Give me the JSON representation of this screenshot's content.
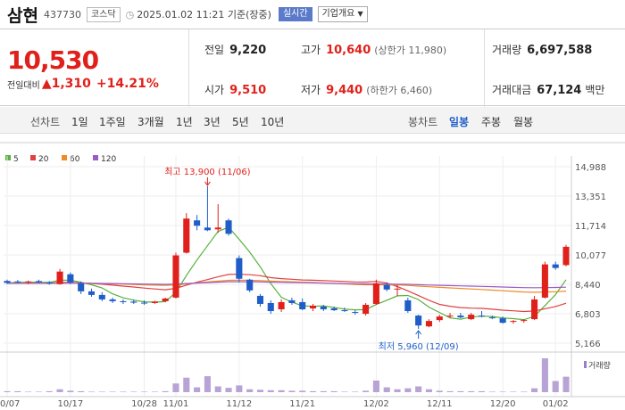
{
  "header": {
    "name": "삼현",
    "code": "437730",
    "market": "코스닥",
    "datetime": "2025.01.02 11:21 기준(장중)",
    "live_label": "실시간",
    "company_info_label": "기업개요"
  },
  "quote": {
    "price": "10,530",
    "change_label": "전일대비",
    "change": "1,310",
    "change_pct": "+14.21%",
    "prev_close_label": "전일",
    "prev_close": "9,220",
    "open_label": "시가",
    "open": "9,510",
    "high_label": "고가",
    "high": "10,640",
    "upper_limit": "(상한가 11,980)",
    "low_label": "저가",
    "low": "9,440",
    "lower_limit": "(하한가 6,460)",
    "volume_label": "거래량",
    "volume": "6,697,588",
    "amount_label": "거래대금",
    "amount": "67,124",
    "amount_unit": "백만"
  },
  "tabs": {
    "line_label": "선차트",
    "line_items": [
      "1일",
      "1주일",
      "3개월",
      "1년",
      "3년",
      "5년",
      "10년"
    ],
    "candle_label": "봉차트",
    "candle_items": [
      "일봉",
      "주봉",
      "월봉"
    ],
    "candle_active": "일봉"
  },
  "colors": {
    "up": "#e0211b",
    "down": "#1f5ec9",
    "ma5": "#57b03c",
    "ma20": "#e04040",
    "ma60": "#f08a24",
    "ma120": "#9a5bc8"
  },
  "chart_data": {
    "type": "candlestick",
    "legend": [
      {
        "label": "5",
        "color": "#57b03c"
      },
      {
        "label": "20",
        "color": "#e04040"
      },
      {
        "label": "60",
        "color": "#f08a24"
      },
      {
        "label": "120",
        "color": "#9a5bc8"
      }
    ],
    "y_ticks": [
      "14,988",
      "13,351",
      "11,714",
      "10,077",
      "8,440",
      "6,803",
      "5,166"
    ],
    "y_tick_values": [
      14988,
      13351,
      11714,
      10077,
      8440,
      6803,
      5166
    ],
    "ylim": [
      5166,
      14988
    ],
    "x_labels": [
      "10/07",
      "10/17",
      "10/28",
      "11/01",
      "11/12",
      "11/21",
      "12/02",
      "12/11",
      "12/20",
      "01/02"
    ],
    "x_label_index": [
      0,
      6,
      13,
      16,
      22,
      28,
      35,
      41,
      47,
      52
    ],
    "volume_label": "거래량",
    "annotation_high": "최고 13,900 (11/06)",
    "annotation_low": "최저 5,960 (12/09)",
    "candles": [
      [
        8630,
        8700,
        8450,
        8520
      ],
      [
        8600,
        8680,
        8480,
        8560
      ],
      [
        8560,
        8650,
        8450,
        8600
      ],
      [
        8620,
        8700,
        8500,
        8550
      ],
      [
        8550,
        8620,
        8420,
        8480
      ],
      [
        8450,
        9300,
        8420,
        9150
      ],
      [
        9000,
        9100,
        8450,
        8550
      ],
      [
        8500,
        8600,
        7900,
        8050
      ],
      [
        8050,
        8200,
        7750,
        7850
      ],
      [
        7850,
        8000,
        7500,
        7600
      ],
      [
        7600,
        7700,
        7400,
        7500
      ],
      [
        7500,
        7600,
        7350,
        7450
      ],
      [
        7480,
        7580,
        7350,
        7420
      ],
      [
        7420,
        7550,
        7300,
        7380
      ],
      [
        7400,
        7520,
        7350,
        7480
      ],
      [
        7500,
        7700,
        7450,
        7650
      ],
      [
        7700,
        10200,
        7650,
        10050
      ],
      [
        10200,
        12400,
        10150,
        12100
      ],
      [
        12000,
        12300,
        11450,
        11700
      ],
      [
        11600,
        13900,
        11400,
        11450
      ],
      [
        11500,
        12900,
        11300,
        11600
      ],
      [
        12000,
        12100,
        11150,
        11250
      ],
      [
        9900,
        10050,
        8550,
        8750
      ],
      [
        8700,
        8750,
        8000,
        8100
      ],
      [
        7800,
        7900,
        7200,
        7350
      ],
      [
        7400,
        7550,
        6800,
        6950
      ],
      [
        7050,
        7600,
        6900,
        7450
      ],
      [
        7550,
        7700,
        7300,
        7400
      ],
      [
        7450,
        7650,
        7000,
        7050
      ],
      [
        7100,
        7350,
        6950,
        7250
      ],
      [
        7200,
        7300,
        6950,
        7050
      ],
      [
        7100,
        7200,
        6950,
        7000
      ],
      [
        7000,
        7150,
        6900,
        6950
      ],
      [
        6900,
        7000,
        6750,
        6850
      ],
      [
        6800,
        7400,
        6700,
        7300
      ],
      [
        7350,
        8700,
        7300,
        8500
      ],
      [
        8400,
        8550,
        8050,
        8150
      ],
      [
        8150,
        8400,
        7800,
        8200
      ],
      [
        7550,
        7700,
        6850,
        6950
      ],
      [
        6700,
        6750,
        5960,
        6150
      ],
      [
        6100,
        6500,
        6050,
        6400
      ],
      [
        6450,
        6750,
        6350,
        6650
      ],
      [
        6650,
        6850,
        6550,
        6700
      ],
      [
        6700,
        6850,
        6550,
        6600
      ],
      [
        6500,
        6850,
        6450,
        6750
      ],
      [
        6700,
        6950,
        6600,
        6650
      ],
      [
        6600,
        6700,
        6500,
        6550
      ],
      [
        6550,
        6650,
        6250,
        6300
      ],
      [
        6350,
        6450,
        6250,
        6400
      ],
      [
        6400,
        6500,
        6300,
        6450
      ],
      [
        6500,
        7800,
        6450,
        7600
      ],
      [
        7700,
        9700,
        7650,
        9550
      ],
      [
        9550,
        9700,
        9250,
        9350
      ],
      [
        9510,
        10640,
        9440,
        10530
      ]
    ],
    "volume": [
      2,
      2,
      1,
      1,
      2,
      6,
      3,
      2,
      1,
      1,
      1,
      1,
      1,
      1,
      1,
      2,
      18,
      30,
      10,
      33,
      12,
      9,
      14,
      6,
      5,
      4,
      4,
      3,
      3,
      2,
      2,
      2,
      1,
      1,
      3,
      24,
      10,
      6,
      8,
      12,
      6,
      3,
      2,
      2,
      2,
      2,
      1,
      1,
      1,
      1,
      8,
      70,
      23,
      32
    ]
  }
}
